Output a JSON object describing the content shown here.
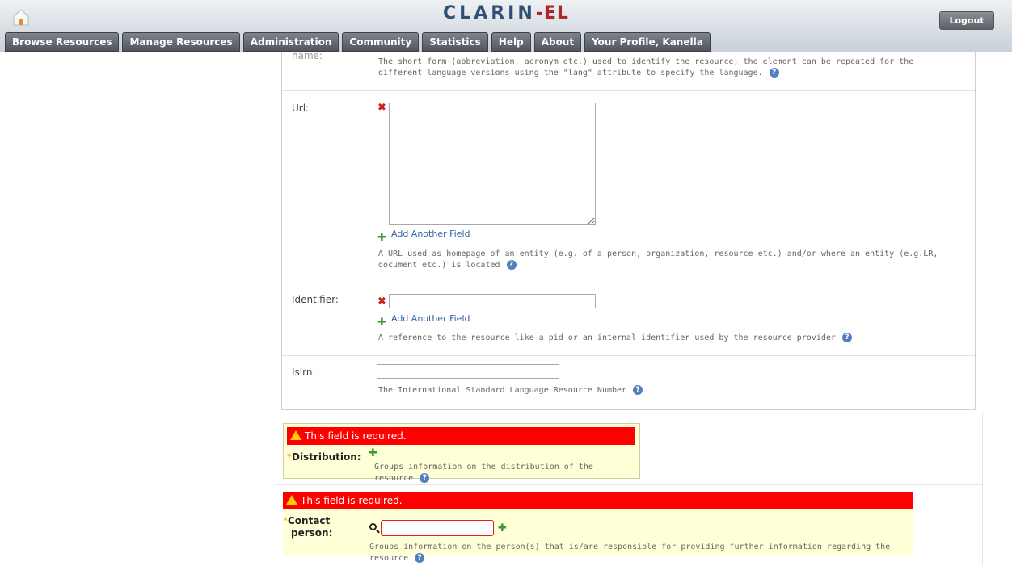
{
  "header": {
    "logo_main": "CLARIN",
    "logo_suffix": "-EL",
    "logout_label": "Logout"
  },
  "nav": {
    "tabs": [
      {
        "label": "Browse Resources"
      },
      {
        "label": "Manage Resources"
      },
      {
        "label": "Administration"
      },
      {
        "label": "Community"
      },
      {
        "label": "Statistics"
      },
      {
        "label": "Help"
      },
      {
        "label": "About"
      },
      {
        "label": "Your Profile, Kanella"
      }
    ]
  },
  "form": {
    "name": {
      "label": "name:",
      "help": "The short form (abbreviation, acronym etc.) used to identify the resource; the element can be repeated for the different language versions using the \"lang\" attribute to specify the language."
    },
    "url": {
      "label": "Url:",
      "value": "",
      "add_label": "Add Another Field",
      "help": "A URL used as homepage of an entity (e.g. of a person, organization, resource etc.) and/or where an entity (e.g.LR, document etc.) is located"
    },
    "identifier": {
      "label": "Identifier:",
      "value": "",
      "add_label": "Add Another Field",
      "help": "A reference to the resource like a pid or an internal identifier used by the resource provider"
    },
    "islrn": {
      "label": "Islrn:",
      "value": "",
      "help": "The International Standard Language Resource Number"
    }
  },
  "distribution": {
    "error": "This field is required.",
    "label": "Distribution:",
    "help": "Groups information on the distribution of the resource"
  },
  "contact": {
    "error": "This field is required.",
    "label_line1": "Contact",
    "label_line2": "person:",
    "value": "",
    "help": "Groups information on the person(s) that is/are responsible for providing further information regarding the resource"
  },
  "colors": {
    "error_bar": "#ff0000",
    "required_bg": "#ffffd8",
    "link": "#3264a8",
    "add_icon": "#3b9a2e",
    "remove_icon": "#cc1f1f"
  }
}
